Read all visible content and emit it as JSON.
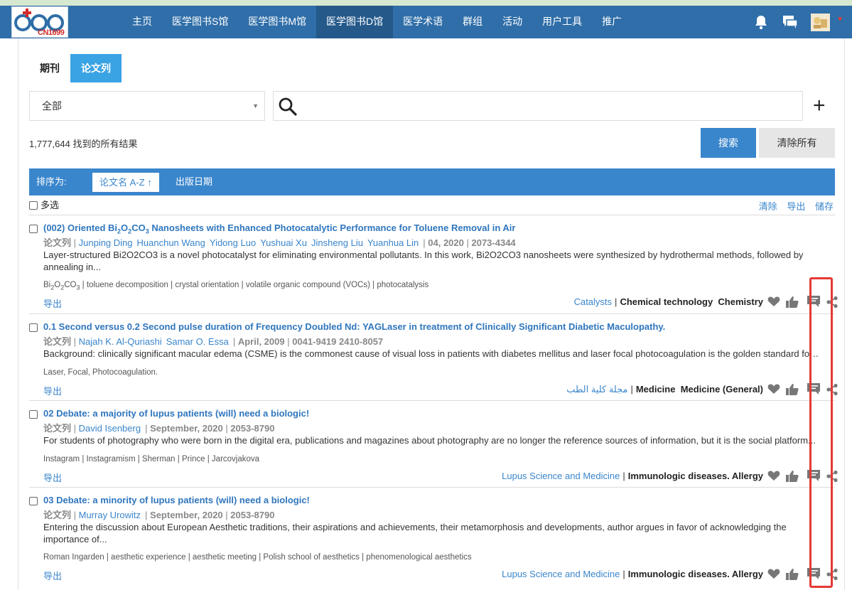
{
  "nav": {
    "logo_text": "CN1699",
    "items": [
      "主页",
      "医学图书S馆",
      "医学图书M馆",
      "医学图书D馆",
      "医学术语",
      "群组",
      "活动",
      "用户工具",
      "推广"
    ],
    "active_index": 3
  },
  "tabs": [
    "期刊",
    "论文列"
  ],
  "active_tab": 1,
  "filter": {
    "selected": "全部"
  },
  "search": {
    "placeholder": "",
    "value": ""
  },
  "results_count": "1,777,644 找到的所有结果",
  "buttons": {
    "search": "搜索",
    "clear_all": "清除所有"
  },
  "sort": {
    "label": "排序为:",
    "title_option": "论文名 A-Z",
    "date_option": "出版日期"
  },
  "multi_select_label": "多选",
  "list_actions": [
    "清除",
    "导出",
    "储存"
  ],
  "export_label": "导出",
  "type_label": "论文列",
  "items": [
    {
      "title": "(002) Oriented Bi2O2CO3 Nanosheets with Enhanced Photocatalytic Performance for Toluene Removal in Air",
      "authors": [
        "Junping Ding",
        "Huanchun Wang",
        "Yidong Luo",
        "Yushuai Xu",
        "Jinsheng Liu",
        "Yuanhua Lin"
      ],
      "date": "04, 2020",
      "issn": "2073-4344",
      "abstract": "Layer-structured Bi2O2CO3 is a novel photocatalyst for eliminating environmental pollutants. In this work, Bi2O2CO3 nanosheets were synthesized by hydrothermal methods, followed by annealing in...",
      "keywords": "Bi2O2CO3 | toluene decomposition | crystal orientation | volatile organic compound (VOCs) | photocatalysis",
      "journal": "Catalysts",
      "categories": "Chemical technology  Chemistry"
    },
    {
      "title": "0.1 Second versus 0.2 Second pulse duration of Frequency Doubled Nd: YAGLaser in treatment of Clinically Significant Diabetic Maculopathy.",
      "authors": [
        "Najah K. Al-Quriashi",
        "Samar O. Essa"
      ],
      "date": "April, 2009",
      "issn": "0041-9419 2410-8057",
      "abstract": "Background: clinically significant macular edema (CSME) is the commonest cause of visual loss in patients with diabetes mellitus and laser focal photocoagulation is the golden standard for...",
      "keywords": "Laser, Focal, Photocoagulation.",
      "journal": "مجلة كلية الطب",
      "categories": "Medicine  Medicine (General)"
    },
    {
      "title": "02 Debate: a majority of lupus patients (will) need a biologic!",
      "authors": [
        "David Isenberg"
      ],
      "date": "September, 2020",
      "issn": "2053-8790",
      "abstract": "For students of photography who were born in the digital era, publications and magazines about photography are no longer the reference sources of information, but it is the social platform...",
      "keywords": "Instagram | Instagramism | Sherman | Prince | Jarcovjakova",
      "journal": "Lupus Science and Medicine",
      "categories": "Immunologic diseases. Allergy"
    },
    {
      "title": "03 Debate: a minority of lupus patients (will) need a biologic!",
      "authors": [
        "Murray Urowitz"
      ],
      "date": "September, 2020",
      "issn": "2053-8790",
      "abstract": "Entering the discussion about European Aesthetic traditions, their aspirations and achievements, their metamorphosis and developments, author argues in favor of acknowledging the importance of...",
      "keywords": "Roman Ingarden | aesthetic experience | aesthetic meeting | Polish school of aesthetics | phenomenological aesthetics",
      "journal": "Lupus Science and Medicine",
      "categories": "Immunologic diseases. Allergy"
    }
  ],
  "colors": {
    "nav": "#2f6ea8",
    "accent": "#3a86cc",
    "tab_active": "#3aa3e3",
    "highlight_box": "#e53935"
  }
}
